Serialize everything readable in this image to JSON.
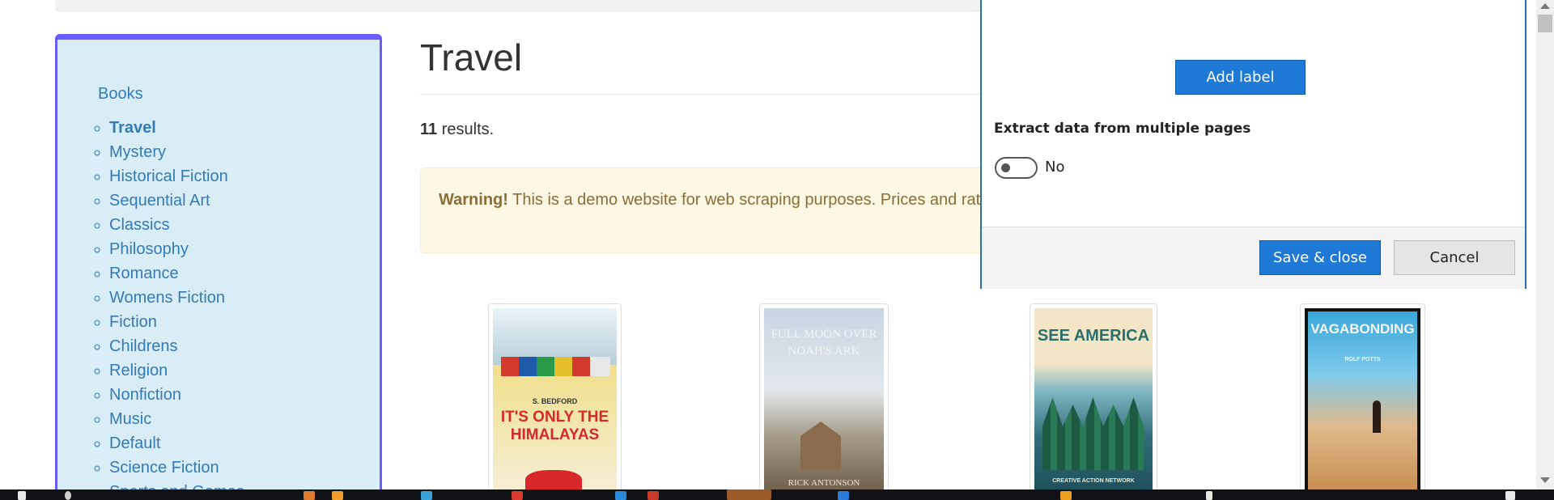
{
  "sidebar": {
    "books_link": "Books",
    "categories": [
      {
        "label": "Travel",
        "active": true
      },
      {
        "label": "Mystery"
      },
      {
        "label": "Historical Fiction"
      },
      {
        "label": "Sequential Art"
      },
      {
        "label": "Classics"
      },
      {
        "label": "Philosophy"
      },
      {
        "label": "Romance"
      },
      {
        "label": "Womens Fiction"
      },
      {
        "label": "Fiction"
      },
      {
        "label": "Childrens"
      },
      {
        "label": "Religion"
      },
      {
        "label": "Nonfiction"
      },
      {
        "label": "Music"
      },
      {
        "label": "Default"
      },
      {
        "label": "Science Fiction"
      },
      {
        "label": "Sports and Games"
      }
    ]
  },
  "main": {
    "title": "Travel",
    "results_count": "11",
    "results_suffix": " results.",
    "warning_strong": "Warning!",
    "warning_text": " This is a demo website for web scraping purposes. Prices and ratings here were randomly assigned and have no real meaning.",
    "books": [
      {
        "cover_title": "IT'S ONLY THE HIMALAYAS",
        "cover_author": "S. BEDFORD",
        "cover_color": "#f3d36b"
      },
      {
        "cover_title": "FULL MOON OVER NOAH'S ARK",
        "cover_author": "RICK ANTONSON",
        "cover_color": "#b9c6d3"
      },
      {
        "cover_title": "SEE AMERICA",
        "cover_author": "CREATIVE ACTION NETWORK",
        "cover_color": "#2f6d7a"
      },
      {
        "cover_title": "VAGABONDING",
        "cover_author": "ROLF POTTS",
        "cover_color": "#39a7d8"
      }
    ]
  },
  "dialog": {
    "add_label_button": "Add label",
    "extract_heading": "Extract data from multiple pages",
    "toggle_label": "No",
    "save_button": "Save & close",
    "cancel_button": "Cancel"
  },
  "colors": {
    "accent": "#1e7ad6",
    "sidebar_border": "#6a5cff",
    "link": "#337ab7",
    "warning_bg": "#fcf8e3"
  }
}
